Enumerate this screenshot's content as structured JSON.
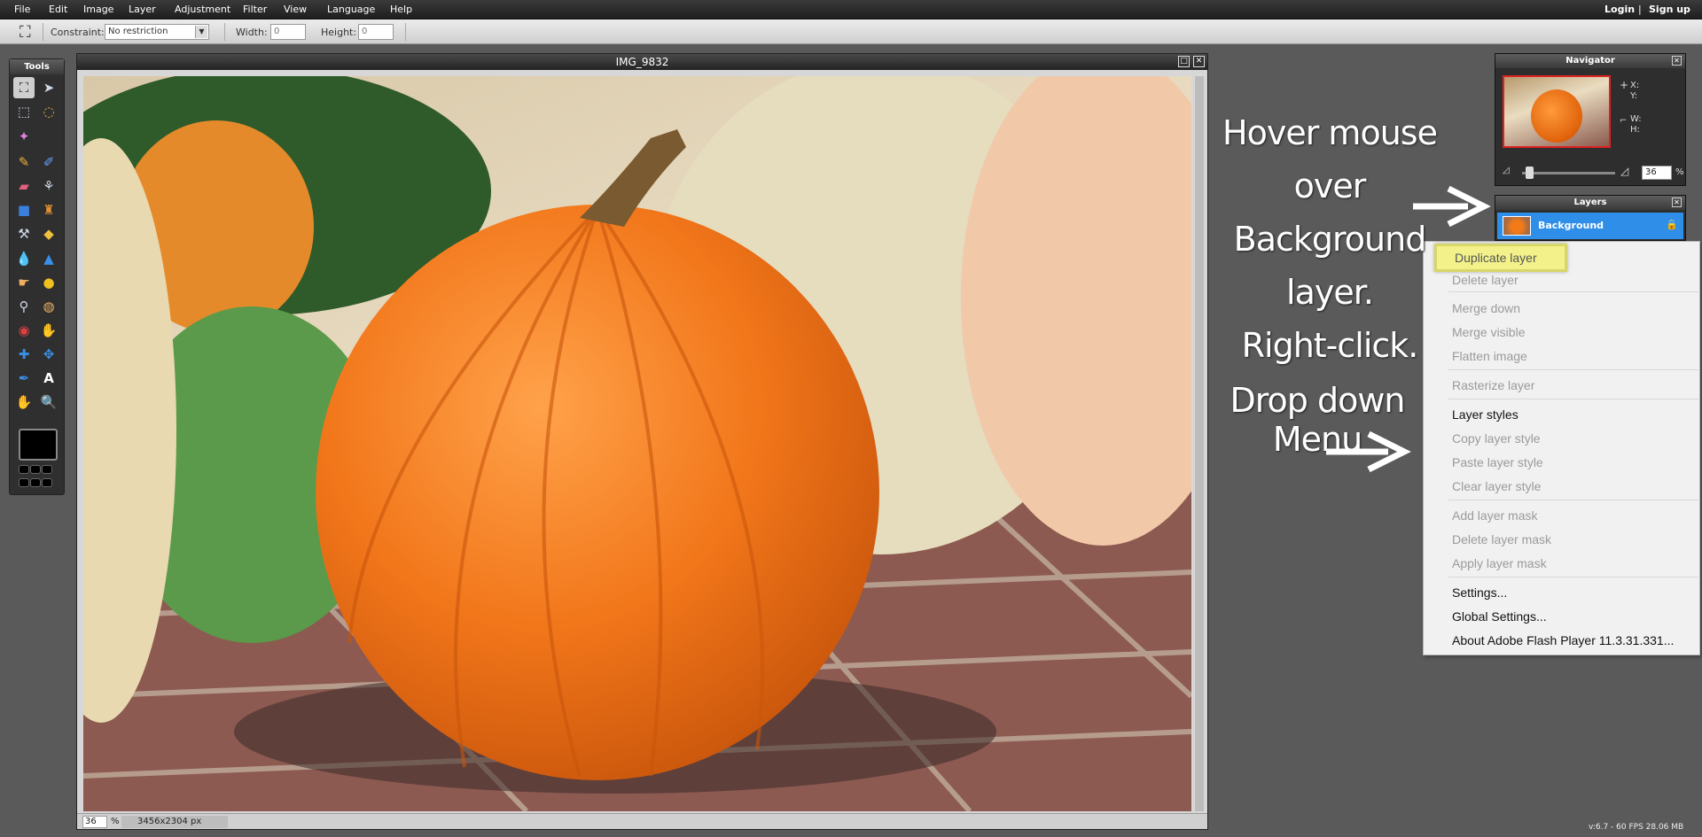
{
  "menubar": {
    "items": [
      "File",
      "Edit",
      "Image",
      "Layer",
      "Adjustment",
      "Filter",
      "View",
      "Language",
      "Help"
    ],
    "login": "Login",
    "separator": "|",
    "signup": "Sign up"
  },
  "options": {
    "constraint_label": "Constraint:",
    "constraint_value": "No restriction",
    "width_label": "Width:",
    "width_value": "0",
    "height_label": "Height:",
    "height_value": "0"
  },
  "tools": {
    "title": "Tools",
    "icons": [
      "crop-icon",
      "move-icon",
      "marquee-icon",
      "lasso-icon",
      "wand-icon",
      "pencil-icon",
      "brush-icon",
      "eraser-icon",
      "replace-color-icon",
      "gradient-icon",
      "clone-stamp-icon",
      "color-replace-icon",
      "shape-icon",
      "blur-icon",
      "sharpen-icon",
      "smudge-icon",
      "sponge-icon",
      "zoom-lens-icon",
      "dodge-icon",
      "red-eye-icon",
      "burn-icon",
      "spot-heal-icon",
      "bloat-icon",
      "color-picker-icon",
      "text-icon",
      "hand-icon",
      "zoom-icon"
    ],
    "foreground_color": "#000000"
  },
  "image_window": {
    "title": "IMG_9832",
    "zoom": "36",
    "zoom_unit": "%",
    "dimensions": "3456x2304 px"
  },
  "navigator": {
    "title": "Navigator",
    "x_label": "X:",
    "y_label": "Y:",
    "w_label": "W:",
    "h_label": "H:",
    "zoom": "36",
    "zoom_unit": "%"
  },
  "layers": {
    "title": "Layers",
    "items": [
      {
        "name": "Background",
        "locked": true
      }
    ]
  },
  "context_menu": {
    "items": [
      {
        "label": "Duplicate layer",
        "enabled": true,
        "highlighted": true
      },
      {
        "label": "Delete layer",
        "enabled": false
      },
      {
        "label": "Merge down",
        "enabled": false
      },
      {
        "label": "Merge visible",
        "enabled": false
      },
      {
        "label": "Flatten image",
        "enabled": false
      },
      {
        "label": "Rasterize layer",
        "enabled": false
      },
      {
        "label": "Layer styles",
        "enabled": true
      },
      {
        "label": "Copy layer style",
        "enabled": false
      },
      {
        "label": "Paste layer style",
        "enabled": false
      },
      {
        "label": "Clear layer style",
        "enabled": false
      },
      {
        "label": "Add layer mask",
        "enabled": false
      },
      {
        "label": "Delete layer mask",
        "enabled": false
      },
      {
        "label": "Apply layer mask",
        "enabled": false
      },
      {
        "label": "Settings...",
        "enabled": true
      },
      {
        "label": "Global Settings...",
        "enabled": true
      },
      {
        "label": "About Adobe Flash Player 11.3.31.331...",
        "enabled": true
      }
    ]
  },
  "annotations": {
    "hover_line1": "Hover mouse over",
    "hover_line2": "Background layer.",
    "hover_line3": "Right-click.",
    "dropdown": "Drop down Menu"
  },
  "footer": {
    "version": "v:6.7 - 60 FPS 28.06 MB"
  },
  "colors": {
    "accent": "#2f8fe8",
    "highlight": "#f3f28a"
  }
}
